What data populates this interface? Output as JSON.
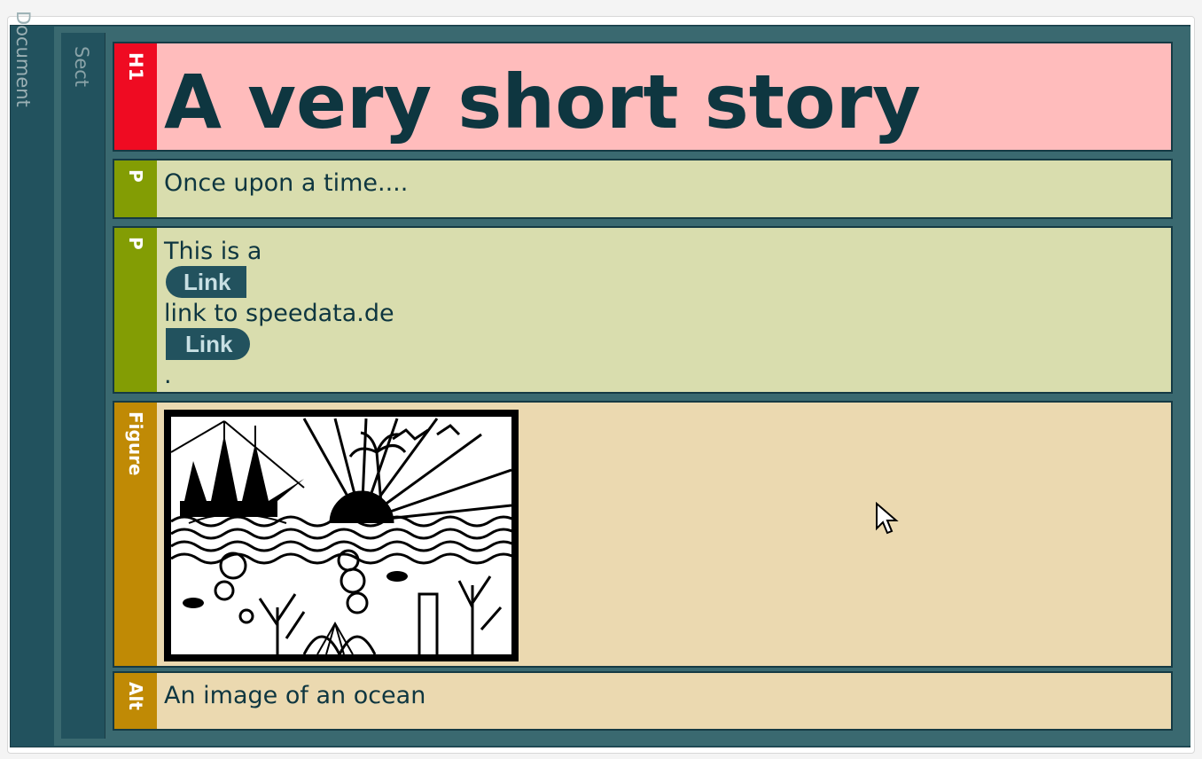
{
  "document": {
    "label": "Document",
    "section_label": "Sect"
  },
  "elements": {
    "h1": {
      "tag": "H1",
      "text": "A very short story"
    },
    "p1": {
      "tag": "P",
      "text": "Once upon a time...."
    },
    "p2": {
      "tag": "P",
      "line1": "This is a",
      "link_label_1": "Link",
      "line2": "link to speedata.de",
      "link_label_2": "Link",
      "line3": "."
    },
    "figure": {
      "tag": "Figure"
    },
    "alt": {
      "tag": "Alt",
      "text": "An image of an ocean"
    }
  },
  "icons": {
    "figure_image": "ocean-papercut-image",
    "cursor": "mouse-pointer-icon"
  },
  "colors": {
    "h1_tag": "#ef0b22",
    "h1_bg": "#ffbcbc",
    "p_tag": "#839d04",
    "p_bg": "#d9ddae",
    "figure_tag": "#c08a05",
    "figure_bg": "#ebd9b0",
    "structure": "#22525e",
    "text": "#0e3640"
  }
}
